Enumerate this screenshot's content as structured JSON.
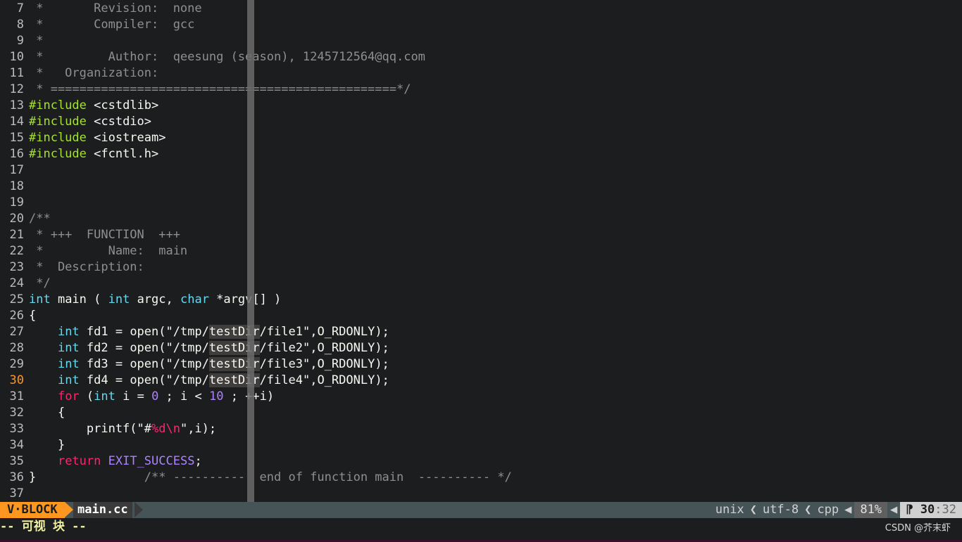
{
  "lines": [
    {
      "num": "7",
      "cur": false,
      "segs": [
        {
          "c": "cmt",
          "t": " *       Revision:  none"
        }
      ]
    },
    {
      "num": "8",
      "cur": false,
      "segs": [
        {
          "c": "cmt",
          "t": " *       Compiler:  gcc"
        }
      ]
    },
    {
      "num": "9",
      "cur": false,
      "segs": [
        {
          "c": "cmt",
          "t": " *"
        }
      ]
    },
    {
      "num": "10",
      "cur": false,
      "segs": [
        {
          "c": "cmt",
          "t": " *         Author:  qeesung (season), 1245712564@qq.com"
        }
      ]
    },
    {
      "num": "11",
      "cur": false,
      "segs": [
        {
          "c": "cmt",
          "t": " *   Organization:  "
        }
      ]
    },
    {
      "num": "12",
      "cur": false,
      "segs": [
        {
          "c": "cmt",
          "t": " * ================================================*/"
        }
      ]
    },
    {
      "num": "13",
      "cur": false,
      "segs": [
        {
          "c": "pre",
          "t": "#include"
        },
        {
          "c": "",
          "t": " <cstdlib>"
        }
      ]
    },
    {
      "num": "14",
      "cur": false,
      "segs": [
        {
          "c": "pre",
          "t": "#include"
        },
        {
          "c": "",
          "t": " <cstdio>"
        }
      ]
    },
    {
      "num": "15",
      "cur": false,
      "segs": [
        {
          "c": "pre",
          "t": "#include"
        },
        {
          "c": "",
          "t": " <iostream>"
        }
      ]
    },
    {
      "num": "16",
      "cur": false,
      "segs": [
        {
          "c": "pre",
          "t": "#include"
        },
        {
          "c": "",
          "t": " <fcntl.h>"
        }
      ]
    },
    {
      "num": "17",
      "cur": false,
      "segs": []
    },
    {
      "num": "18",
      "cur": false,
      "segs": []
    },
    {
      "num": "19",
      "cur": false,
      "segs": []
    },
    {
      "num": "20",
      "cur": false,
      "segs": [
        {
          "c": "cmt",
          "t": "/**"
        }
      ]
    },
    {
      "num": "21",
      "cur": false,
      "segs": [
        {
          "c": "cmt",
          "t": " * +++  FUNCTION  +++"
        }
      ]
    },
    {
      "num": "22",
      "cur": false,
      "segs": [
        {
          "c": "cmt",
          "t": " *         Name:  main"
        }
      ]
    },
    {
      "num": "23",
      "cur": false,
      "segs": [
        {
          "c": "cmt",
          "t": " *  Description:  "
        }
      ]
    },
    {
      "num": "24",
      "cur": false,
      "segs": [
        {
          "c": "cmt",
          "t": " */"
        }
      ]
    },
    {
      "num": "25",
      "cur": false,
      "segs": [
        {
          "c": "kw",
          "t": "int"
        },
        {
          "c": "",
          "t": " main ( "
        },
        {
          "c": "kw",
          "t": "int"
        },
        {
          "c": "",
          "t": " argc, "
        },
        {
          "c": "kw",
          "t": "char"
        },
        {
          "c": "",
          "t": " *argv[] )"
        }
      ]
    },
    {
      "num": "26",
      "cur": false,
      "segs": [
        {
          "c": "",
          "t": "{"
        }
      ]
    },
    {
      "num": "27",
      "cur": false,
      "segs": [
        {
          "c": "",
          "t": "    "
        },
        {
          "c": "kw",
          "t": "int"
        },
        {
          "c": "",
          "t": " fd1 = open(\"/tmp/"
        },
        {
          "c": "sel",
          "t": "testDir"
        },
        {
          "c": "",
          "t": "/file1\",O_RDONLY);"
        }
      ]
    },
    {
      "num": "28",
      "cur": false,
      "segs": [
        {
          "c": "",
          "t": "    "
        },
        {
          "c": "kw",
          "t": "int"
        },
        {
          "c": "",
          "t": " fd2 = open(\"/tmp/"
        },
        {
          "c": "sel",
          "t": "testDir"
        },
        {
          "c": "",
          "t": "/file2\",O_RDONLY);"
        }
      ]
    },
    {
      "num": "29",
      "cur": false,
      "segs": [
        {
          "c": "",
          "t": "    "
        },
        {
          "c": "kw",
          "t": "int"
        },
        {
          "c": "",
          "t": " fd3 = open(\"/tmp/"
        },
        {
          "c": "sel",
          "t": "testDir"
        },
        {
          "c": "",
          "t": "/file3\",O_RDONLY);"
        }
      ]
    },
    {
      "num": "30",
      "cur": true,
      "segs": [
        {
          "c": "",
          "t": "    "
        },
        {
          "c": "kw",
          "t": "int"
        },
        {
          "c": "",
          "t": " fd4 = open(\"/tmp/"
        },
        {
          "c": "sel",
          "t": "testDir"
        },
        {
          "c": "",
          "t": "/file4\",O_RDONLY);"
        }
      ]
    },
    {
      "num": "31",
      "cur": false,
      "segs": [
        {
          "c": "",
          "t": "    "
        },
        {
          "c": "ctl",
          "t": "for"
        },
        {
          "c": "",
          "t": " ("
        },
        {
          "c": "kw",
          "t": "int"
        },
        {
          "c": "",
          "t": " i = "
        },
        {
          "c": "num",
          "t": "0"
        },
        {
          "c": "",
          "t": " ; i < "
        },
        {
          "c": "num",
          "t": "10"
        },
        {
          "c": "",
          "t": " ; ++i)"
        }
      ]
    },
    {
      "num": "32",
      "cur": false,
      "segs": [
        {
          "c": "",
          "t": "    {"
        }
      ]
    },
    {
      "num": "33",
      "cur": false,
      "segs": [
        {
          "c": "",
          "t": "        printf(\"#"
        },
        {
          "c": "esc",
          "t": "%d\\n"
        },
        {
          "c": "",
          "t": "\",i);"
        }
      ]
    },
    {
      "num": "34",
      "cur": false,
      "segs": [
        {
          "c": "",
          "t": "    }"
        }
      ]
    },
    {
      "num": "35",
      "cur": false,
      "segs": [
        {
          "c": "",
          "t": "    "
        },
        {
          "c": "ctl",
          "t": "return"
        },
        {
          "c": "",
          "t": " "
        },
        {
          "c": "const",
          "t": "EXIT_SUCCESS"
        },
        {
          "c": "",
          "t": ";"
        }
      ]
    },
    {
      "num": "36",
      "cur": false,
      "segs": [
        {
          "c": "",
          "t": "}"
        },
        {
          "c": "cmt",
          "t": "               /** ----------  end of function main  ---------- */"
        }
      ]
    },
    {
      "num": "37",
      "cur": false,
      "segs": []
    }
  ],
  "statusline": {
    "mode": "V·BLOCK",
    "filename": "main.cc",
    "fileformat": "unix",
    "sep1": "❮",
    "encoding": "utf-8",
    "sep2": "❮",
    "filetype": "cpp",
    "sep3": "◀",
    "percent": "81%",
    "sep4": "◀",
    "line_icon": "⁋",
    "line": "30",
    "col": ":32"
  },
  "cmdline": {
    "text": "-- 可视 块 --"
  },
  "watermark": "CSDN @芥末虾",
  "colors": {
    "background": "#1b1d1e",
    "mode_bg": "#fd971f",
    "statusline_bg": "#465457",
    "preproc": "#a6e22e",
    "type_keyword": "#66d9ef",
    "control_keyword": "#f92672",
    "number": "#ae81ff",
    "comment": "#8f8f8f"
  }
}
